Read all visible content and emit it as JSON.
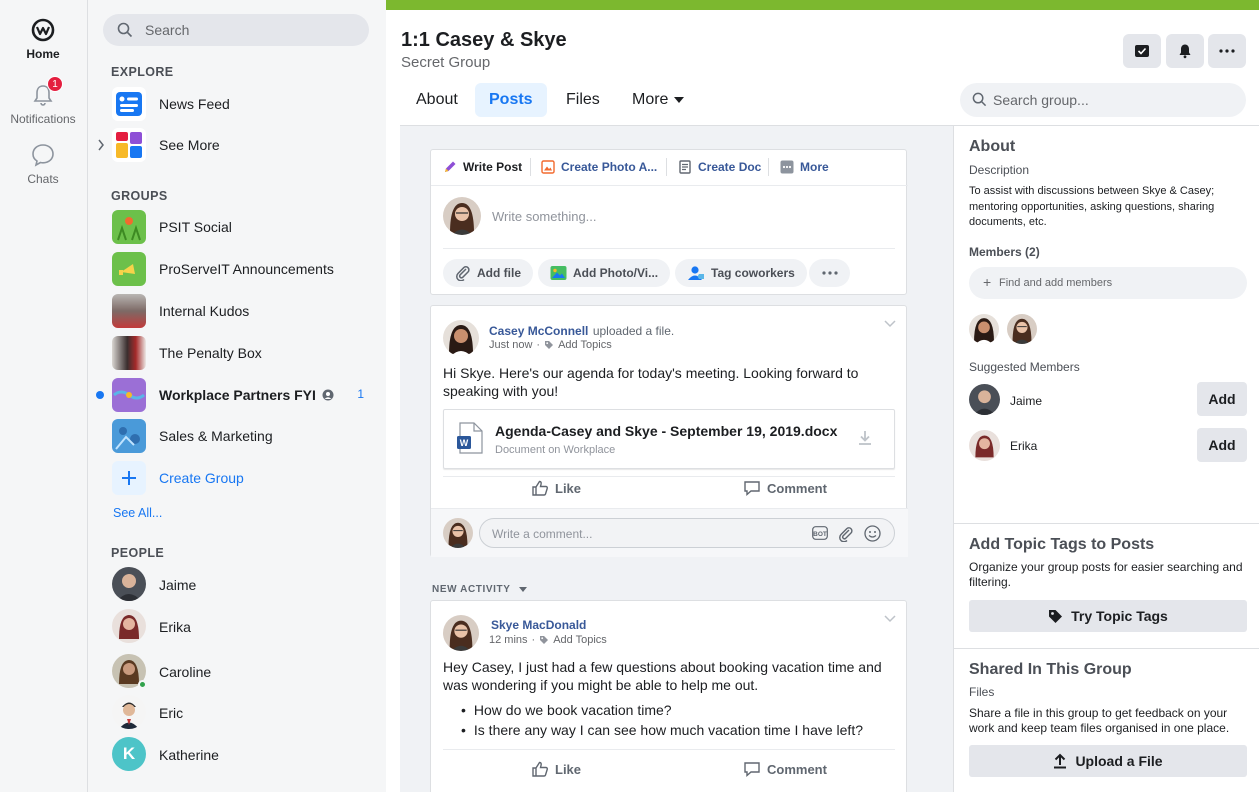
{
  "rail": {
    "home_label": "Home",
    "notifications_label": "Notifications",
    "notifications_badge": "1",
    "chats_label": "Chats"
  },
  "nav": {
    "search_placeholder": "Search",
    "explore_header": "EXPLORE",
    "explore_items": [
      {
        "label": "News Feed"
      },
      {
        "label": "See More"
      }
    ],
    "groups_header": "GROUPS",
    "groups": [
      {
        "label": "PSIT Social"
      },
      {
        "label": "ProServeIT Announcements"
      },
      {
        "label": "Internal Kudos"
      },
      {
        "label": "The Penalty Box"
      },
      {
        "label": "Workplace Partners FYI",
        "count": "1"
      },
      {
        "label": "Sales & Marketing"
      },
      {
        "label": "Create Group"
      }
    ],
    "see_all": "See All...",
    "people_header": "PEOPLE",
    "people": [
      {
        "label": "Jaime"
      },
      {
        "label": "Erika"
      },
      {
        "label": "Caroline"
      },
      {
        "label": "Eric"
      },
      {
        "label": "Katherine",
        "initial": "K"
      }
    ]
  },
  "header": {
    "title": "1:1 Casey & Skye",
    "subtitle": "Secret Group",
    "tabs": [
      {
        "label": "About"
      },
      {
        "label": "Posts"
      },
      {
        "label": "Files"
      },
      {
        "label": "More"
      }
    ],
    "search_placeholder": "Search group..."
  },
  "composer": {
    "tabs": [
      {
        "label": "Write Post"
      },
      {
        "label": "Create Photo A..."
      },
      {
        "label": "Create Doc"
      },
      {
        "label": "More"
      }
    ],
    "placeholder": "Write something...",
    "actions": [
      {
        "label": "Add file"
      },
      {
        "label": "Add Photo/Vi..."
      },
      {
        "label": "Tag coworkers"
      }
    ]
  },
  "post1": {
    "author": "Casey McConnell",
    "verb": "uploaded a file.",
    "time": "Just now",
    "topics": "Add Topics",
    "text": "Hi Skye. Here's our agenda for today's meeting. Looking forward to speaking with you!",
    "file_name": "Agenda-Casey and Skye - September 19, 2019.docx",
    "file_sub": "Document on Workplace",
    "like": "Like",
    "comment": "Comment",
    "comment_placeholder": "Write a comment..."
  },
  "new_activity": "NEW ACTIVITY",
  "post2": {
    "author": "Skye MacDonald",
    "time": "12 mins",
    "topics": "Add Topics",
    "text": "Hey Casey, I just had a few questions about booking vacation time and was wondering if you might be able to help me out.",
    "bullets": [
      "How do we book vacation time?",
      "Is there any way I can see how much vacation time I have left?"
    ],
    "like": "Like",
    "comment": "Comment"
  },
  "right": {
    "about_title": "About",
    "description_label": "Description",
    "description": "To assist with discussions between Skye & Casey; mentoring opportunities, asking questions, sharing documents, etc.",
    "members_label": "Members (2)",
    "find_members": "Find and add members",
    "suggested_label": "Suggested Members",
    "suggested": [
      {
        "name": "Jaime",
        "button": "Add"
      },
      {
        "name": "Erika",
        "button": "Add"
      }
    ],
    "topic_title": "Add Topic Tags to Posts",
    "topic_text": "Organize your group posts for easier searching and filtering.",
    "topic_button": "Try Topic Tags",
    "shared_title": "Shared In This Group",
    "files_label": "Files",
    "shared_text": "Share a file in this group to get feedback on your work and keep team files organised in one place.",
    "upload_button": "Upload a File"
  },
  "colors": {
    "accent": "#1877f2",
    "brand_bar": "#7cb82f",
    "badge": "#e41e3f",
    "link": "#385898",
    "online": "#31a24c"
  }
}
